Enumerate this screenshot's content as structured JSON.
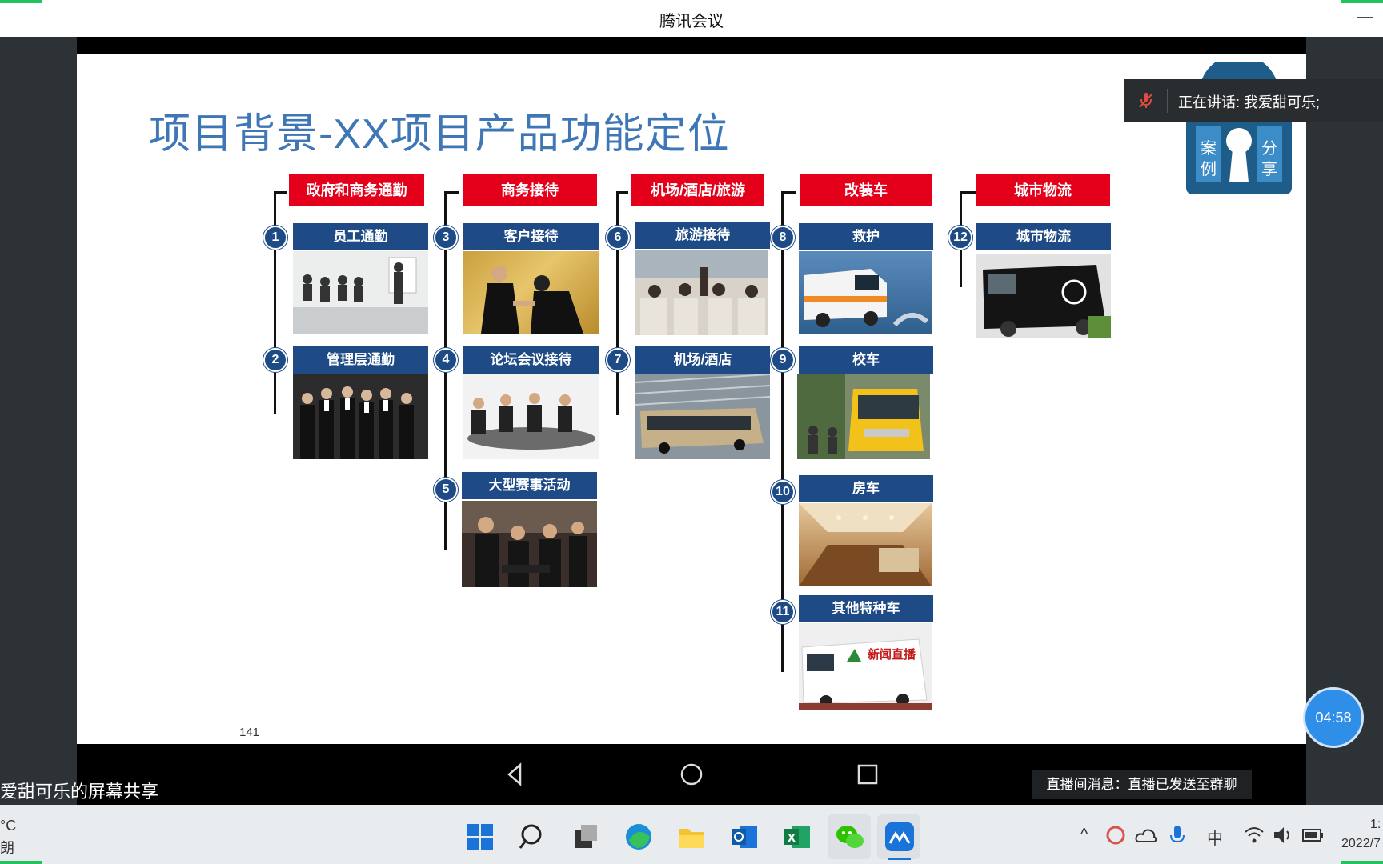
{
  "window": {
    "title": "腾讯会议",
    "minimize_icon": "—"
  },
  "slide": {
    "title": "项目背景-XX项目产品功能定位",
    "page_number": "141",
    "categories": [
      {
        "label": "政府和商务通勤"
      },
      {
        "label": "商务接待"
      },
      {
        "label": "机场/酒店/旅游"
      },
      {
        "label": "改装车"
      },
      {
        "label": "城市物流"
      }
    ],
    "items": [
      {
        "num": "1",
        "label": "员工通勤"
      },
      {
        "num": "2",
        "label": "管理层通勤"
      },
      {
        "num": "3",
        "label": "客户接待"
      },
      {
        "num": "4",
        "label": "论坛会议接待"
      },
      {
        "num": "5",
        "label": "大型赛事活动"
      },
      {
        "num": "6",
        "label": "旅游接待"
      },
      {
        "num": "7",
        "label": "机场/酒店"
      },
      {
        "num": "8",
        "label": "救护"
      },
      {
        "num": "9",
        "label": "校车"
      },
      {
        "num": "10",
        "label": "房车"
      },
      {
        "num": "11",
        "label": "其他特种车"
      },
      {
        "num": "12",
        "label": "城市物流"
      }
    ],
    "photo_captions": {
      "news_van": "新闻直播"
    }
  },
  "badge": {
    "left": "案例",
    "right": "分享"
  },
  "speaker": {
    "text": "正在讲话: 我爱甜可乐;"
  },
  "timer": "04:58",
  "live_message": "直播间消息：直播已发送至群聊",
  "screenshare_label": "爱甜可乐的屏幕共享",
  "weather": {
    "temp": "°C",
    "desc": "朗"
  },
  "taskbar": {
    "apps": [
      "windows-start-icon",
      "search-icon",
      "task-view-icon",
      "edge-icon",
      "file-explorer-icon",
      "outlook-icon",
      "excel-icon",
      "wechat-icon",
      "tencent-meeting-icon"
    ],
    "tray": {
      "chevron": "^",
      "ime": "中"
    }
  },
  "clock": {
    "time": "1:",
    "date": "2022/7"
  },
  "colors": {
    "accent_blue": "#1e4b86",
    "category_red": "#e4001b",
    "title_blue": "#3f77b6",
    "timer_blue": "#2f8ee8"
  }
}
